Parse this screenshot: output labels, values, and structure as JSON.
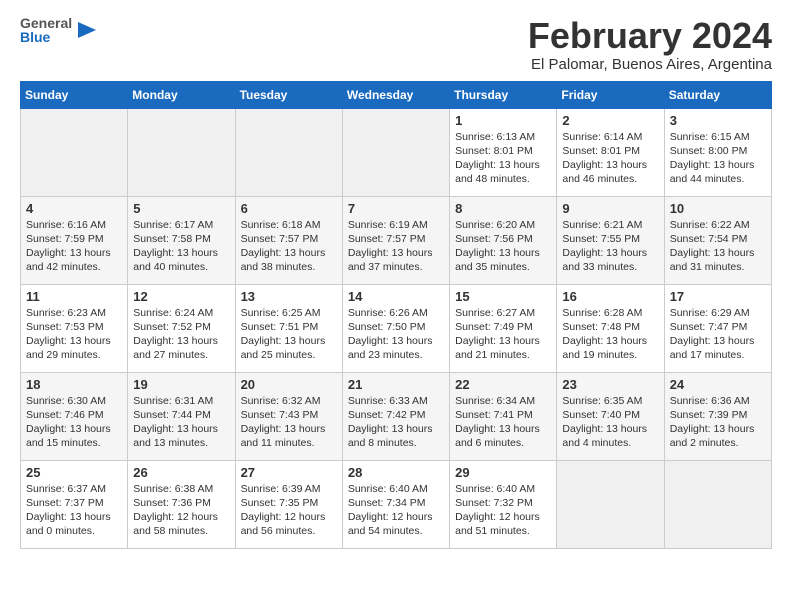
{
  "logo": {
    "general": "General",
    "blue": "Blue"
  },
  "title": "February 2024",
  "subtitle": "El Palomar, Buenos Aires, Argentina",
  "days_of_week": [
    "Sunday",
    "Monday",
    "Tuesday",
    "Wednesday",
    "Thursday",
    "Friday",
    "Saturday"
  ],
  "weeks": [
    [
      {
        "day": "",
        "detail": ""
      },
      {
        "day": "",
        "detail": ""
      },
      {
        "day": "",
        "detail": ""
      },
      {
        "day": "",
        "detail": ""
      },
      {
        "day": "1",
        "detail": "Sunrise: 6:13 AM\nSunset: 8:01 PM\nDaylight: 13 hours\nand 48 minutes."
      },
      {
        "day": "2",
        "detail": "Sunrise: 6:14 AM\nSunset: 8:01 PM\nDaylight: 13 hours\nand 46 minutes."
      },
      {
        "day": "3",
        "detail": "Sunrise: 6:15 AM\nSunset: 8:00 PM\nDaylight: 13 hours\nand 44 minutes."
      }
    ],
    [
      {
        "day": "4",
        "detail": "Sunrise: 6:16 AM\nSunset: 7:59 PM\nDaylight: 13 hours\nand 42 minutes."
      },
      {
        "day": "5",
        "detail": "Sunrise: 6:17 AM\nSunset: 7:58 PM\nDaylight: 13 hours\nand 40 minutes."
      },
      {
        "day": "6",
        "detail": "Sunrise: 6:18 AM\nSunset: 7:57 PM\nDaylight: 13 hours\nand 38 minutes."
      },
      {
        "day": "7",
        "detail": "Sunrise: 6:19 AM\nSunset: 7:57 PM\nDaylight: 13 hours\nand 37 minutes."
      },
      {
        "day": "8",
        "detail": "Sunrise: 6:20 AM\nSunset: 7:56 PM\nDaylight: 13 hours\nand 35 minutes."
      },
      {
        "day": "9",
        "detail": "Sunrise: 6:21 AM\nSunset: 7:55 PM\nDaylight: 13 hours\nand 33 minutes."
      },
      {
        "day": "10",
        "detail": "Sunrise: 6:22 AM\nSunset: 7:54 PM\nDaylight: 13 hours\nand 31 minutes."
      }
    ],
    [
      {
        "day": "11",
        "detail": "Sunrise: 6:23 AM\nSunset: 7:53 PM\nDaylight: 13 hours\nand 29 minutes."
      },
      {
        "day": "12",
        "detail": "Sunrise: 6:24 AM\nSunset: 7:52 PM\nDaylight: 13 hours\nand 27 minutes."
      },
      {
        "day": "13",
        "detail": "Sunrise: 6:25 AM\nSunset: 7:51 PM\nDaylight: 13 hours\nand 25 minutes."
      },
      {
        "day": "14",
        "detail": "Sunrise: 6:26 AM\nSunset: 7:50 PM\nDaylight: 13 hours\nand 23 minutes."
      },
      {
        "day": "15",
        "detail": "Sunrise: 6:27 AM\nSunset: 7:49 PM\nDaylight: 13 hours\nand 21 minutes."
      },
      {
        "day": "16",
        "detail": "Sunrise: 6:28 AM\nSunset: 7:48 PM\nDaylight: 13 hours\nand 19 minutes."
      },
      {
        "day": "17",
        "detail": "Sunrise: 6:29 AM\nSunset: 7:47 PM\nDaylight: 13 hours\nand 17 minutes."
      }
    ],
    [
      {
        "day": "18",
        "detail": "Sunrise: 6:30 AM\nSunset: 7:46 PM\nDaylight: 13 hours\nand 15 minutes."
      },
      {
        "day": "19",
        "detail": "Sunrise: 6:31 AM\nSunset: 7:44 PM\nDaylight: 13 hours\nand 13 minutes."
      },
      {
        "day": "20",
        "detail": "Sunrise: 6:32 AM\nSunset: 7:43 PM\nDaylight: 13 hours\nand 11 minutes."
      },
      {
        "day": "21",
        "detail": "Sunrise: 6:33 AM\nSunset: 7:42 PM\nDaylight: 13 hours\nand 8 minutes."
      },
      {
        "day": "22",
        "detail": "Sunrise: 6:34 AM\nSunset: 7:41 PM\nDaylight: 13 hours\nand 6 minutes."
      },
      {
        "day": "23",
        "detail": "Sunrise: 6:35 AM\nSunset: 7:40 PM\nDaylight: 13 hours\nand 4 minutes."
      },
      {
        "day": "24",
        "detail": "Sunrise: 6:36 AM\nSunset: 7:39 PM\nDaylight: 13 hours\nand 2 minutes."
      }
    ],
    [
      {
        "day": "25",
        "detail": "Sunrise: 6:37 AM\nSunset: 7:37 PM\nDaylight: 13 hours\nand 0 minutes."
      },
      {
        "day": "26",
        "detail": "Sunrise: 6:38 AM\nSunset: 7:36 PM\nDaylight: 12 hours\nand 58 minutes."
      },
      {
        "day": "27",
        "detail": "Sunrise: 6:39 AM\nSunset: 7:35 PM\nDaylight: 12 hours\nand 56 minutes."
      },
      {
        "day": "28",
        "detail": "Sunrise: 6:40 AM\nSunset: 7:34 PM\nDaylight: 12 hours\nand 54 minutes."
      },
      {
        "day": "29",
        "detail": "Sunrise: 6:40 AM\nSunset: 7:32 PM\nDaylight: 12 hours\nand 51 minutes."
      },
      {
        "day": "",
        "detail": ""
      },
      {
        "day": "",
        "detail": ""
      }
    ]
  ]
}
